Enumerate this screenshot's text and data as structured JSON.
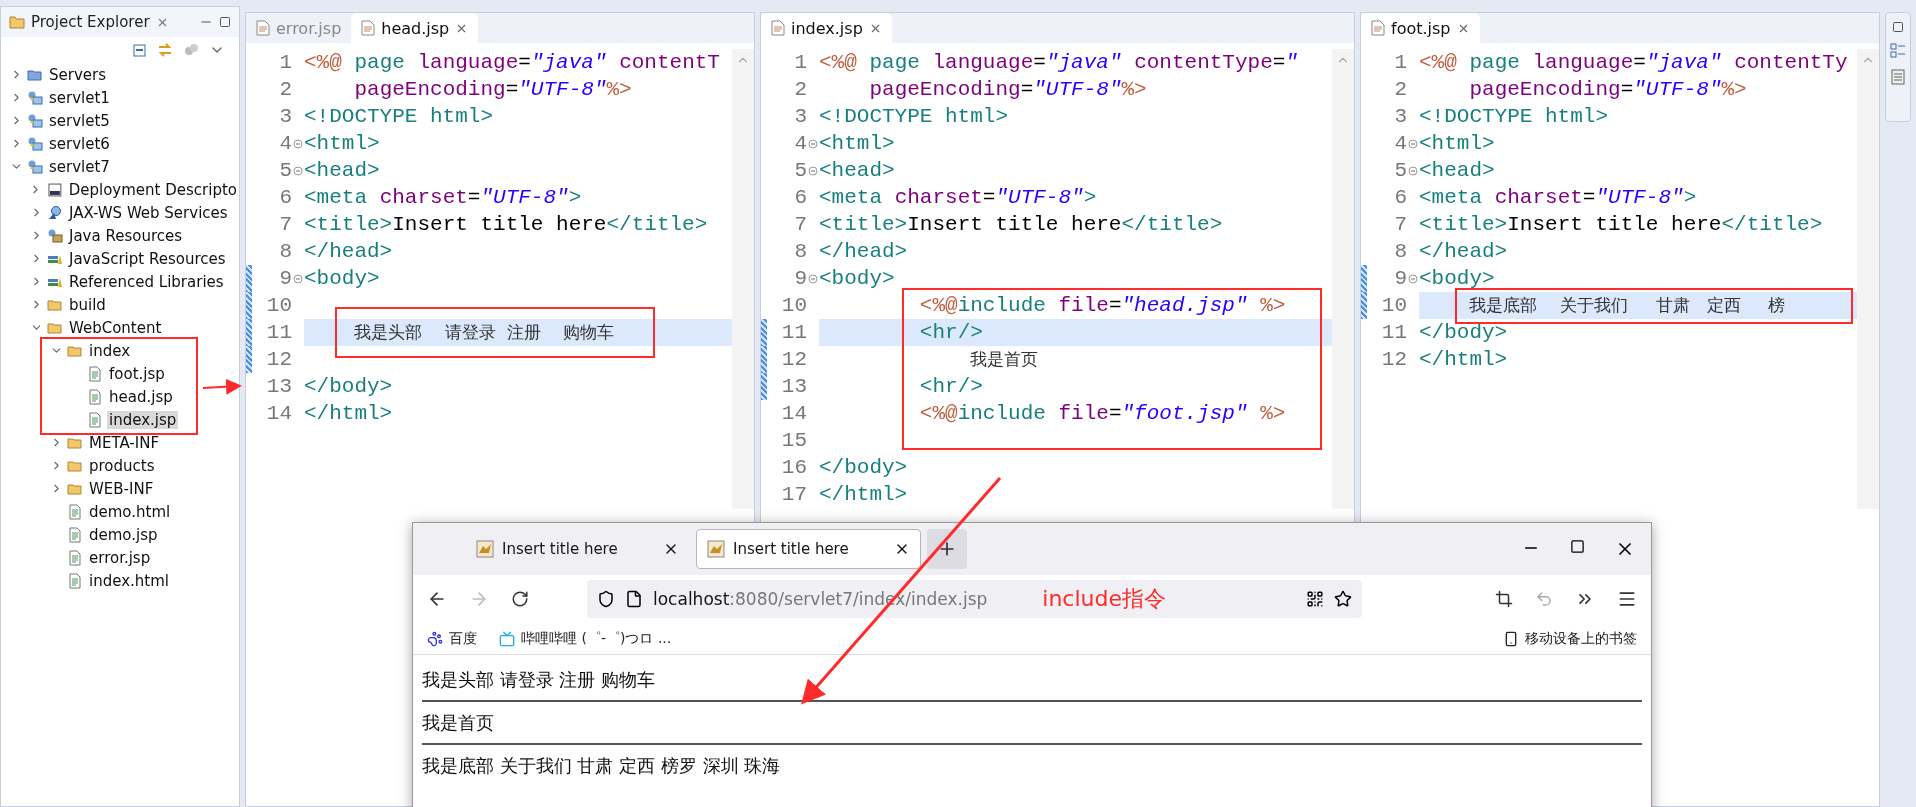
{
  "explorer": {
    "title": "Project Explorer",
    "tree": [
      {
        "label": "Servers",
        "kind": "servers",
        "expanded": false,
        "selected": false
      },
      {
        "label": "servlet1",
        "kind": "project",
        "expanded": false,
        "selected": false
      },
      {
        "label": "servlet5",
        "kind": "project",
        "expanded": false,
        "selected": false
      },
      {
        "label": "servlet6",
        "kind": "project",
        "expanded": false,
        "selected": false
      },
      {
        "label": "servlet7",
        "kind": "project",
        "expanded": true,
        "selected": false,
        "children": [
          {
            "label": "Deployment Descripto",
            "kind": "deploy",
            "expanded": false,
            "selected": false
          },
          {
            "label": "JAX-WS Web Services",
            "kind": "webservice",
            "expanded": false,
            "selected": false
          },
          {
            "label": "Java Resources",
            "kind": "javares",
            "expanded": false,
            "selected": false
          },
          {
            "label": "JavaScript Resources",
            "kind": "library",
            "expanded": false,
            "selected": false
          },
          {
            "label": "Referenced Libraries",
            "kind": "library",
            "expanded": false,
            "selected": false
          },
          {
            "label": "build",
            "kind": "folder",
            "expanded": false,
            "selected": false
          },
          {
            "label": "WebContent",
            "kind": "folder",
            "expanded": true,
            "selected": false,
            "children": [
              {
                "label": "index",
                "kind": "folder",
                "expanded": true,
                "selected": false,
                "children": [
                  {
                    "label": "foot.jsp",
                    "kind": "file",
                    "selected": false
                  },
                  {
                    "label": "head.jsp",
                    "kind": "file",
                    "selected": false
                  },
                  {
                    "label": "index.jsp",
                    "kind": "file",
                    "selected": true
                  }
                ]
              },
              {
                "label": "META-INF",
                "kind": "folder",
                "expanded": false,
                "selected": false
              },
              {
                "label": "products",
                "kind": "folder",
                "expanded": false,
                "selected": false
              },
              {
                "label": "WEB-INF",
                "kind": "folder",
                "expanded": false,
                "selected": false
              },
              {
                "label": "demo.html",
                "kind": "file",
                "selected": false
              },
              {
                "label": "demo.jsp",
                "kind": "file",
                "selected": false
              },
              {
                "label": "error.jsp",
                "kind": "file",
                "selected": false
              },
              {
                "label": "index.html",
                "kind": "file",
                "selected": false
              }
            ]
          }
        ]
      }
    ]
  },
  "editors": [
    {
      "tabs": [
        {
          "label": "error.jsp",
          "selected": false
        },
        {
          "label": "head.jsp",
          "selected": true
        }
      ],
      "lines": [
        {
          "n": "1",
          "fold": false,
          "changed": false,
          "current": false,
          "t": [
            {
              "kind": "delim",
              "text": "<%@"
            },
            {
              "kind": "tag",
              "text": " page"
            },
            {
              "kind": "attr",
              "text": " language"
            },
            {
              "kind": "text",
              "text": "="
            },
            {
              "kind": "str",
              "text": "\"java\""
            },
            {
              "kind": "attr",
              "text": " contentT"
            }
          ]
        },
        {
          "n": "2",
          "fold": false,
          "changed": false,
          "current": false,
          "t": [
            {
              "kind": "attr",
              "text": "    pageEncoding"
            },
            {
              "kind": "text",
              "text": "="
            },
            {
              "kind": "str",
              "text": "\"UTF-8\""
            },
            {
              "kind": "delim",
              "text": "%>"
            }
          ]
        },
        {
          "n": "3",
          "fold": false,
          "changed": false,
          "current": false,
          "t": [
            {
              "kind": "tag",
              "text": "<!DOCTYPE html>"
            }
          ]
        },
        {
          "n": "4",
          "fold": true,
          "changed": false,
          "current": false,
          "t": [
            {
              "kind": "tag",
              "text": "<html>"
            }
          ]
        },
        {
          "n": "5",
          "fold": true,
          "changed": false,
          "current": false,
          "t": [
            {
              "kind": "tag",
              "text": "<head>"
            }
          ]
        },
        {
          "n": "6",
          "fold": false,
          "changed": false,
          "current": false,
          "t": [
            {
              "kind": "tag",
              "text": "<meta"
            },
            {
              "kind": "attr",
              "text": " charset"
            },
            {
              "kind": "text",
              "text": "="
            },
            {
              "kind": "str",
              "text": "\"UTF-8\""
            },
            {
              "kind": "tag",
              "text": ">"
            }
          ]
        },
        {
          "n": "7",
          "fold": false,
          "changed": false,
          "current": false,
          "t": [
            {
              "kind": "tag",
              "text": "<title>"
            },
            {
              "kind": "text",
              "text": "Insert title here"
            },
            {
              "kind": "tag",
              "text": "</title>"
            }
          ]
        },
        {
          "n": "8",
          "fold": false,
          "changed": false,
          "current": false,
          "t": [
            {
              "kind": "tag",
              "text": "</head>"
            }
          ]
        },
        {
          "n": "9",
          "fold": true,
          "changed": true,
          "current": false,
          "t": [
            {
              "kind": "tag",
              "text": "<body>"
            }
          ]
        },
        {
          "n": "10",
          "fold": false,
          "changed": true,
          "current": false
        },
        {
          "n": "11",
          "fold": false,
          "changed": true,
          "current": true,
          "t": [
            {
              "kind": "cjk",
              "text": "    我是头部　 请登录  注册　 购物车"
            }
          ]
        },
        {
          "n": "12",
          "fold": false,
          "changed": true,
          "current": false
        },
        {
          "n": "13",
          "fold": false,
          "changed": false,
          "current": false,
          "t": [
            {
              "kind": "tag",
              "text": "</body>"
            }
          ]
        },
        {
          "n": "14",
          "fold": false,
          "changed": false,
          "current": false,
          "t": [
            {
              "kind": "tag",
              "text": "</html>"
            }
          ]
        }
      ]
    },
    {
      "tabs": [
        {
          "label": "index.jsp",
          "selected": true
        }
      ],
      "lines": [
        {
          "n": "1",
          "fold": false,
          "changed": false,
          "current": false,
          "t": [
            {
              "kind": "delim",
              "text": "<%@"
            },
            {
              "kind": "tag",
              "text": " page"
            },
            {
              "kind": "attr",
              "text": " language"
            },
            {
              "kind": "text",
              "text": "="
            },
            {
              "kind": "str",
              "text": "\"java\""
            },
            {
              "kind": "attr",
              "text": " contentType"
            },
            {
              "kind": "text",
              "text": "="
            },
            {
              "kind": "str",
              "text": "\""
            }
          ]
        },
        {
          "n": "2",
          "fold": false,
          "changed": false,
          "current": false,
          "t": [
            {
              "kind": "attr",
              "text": "    pageEncoding"
            },
            {
              "kind": "text",
              "text": "="
            },
            {
              "kind": "str",
              "text": "\"UTF-8\""
            },
            {
              "kind": "delim",
              "text": "%>"
            }
          ]
        },
        {
          "n": "3",
          "fold": false,
          "changed": false,
          "current": false,
          "t": [
            {
              "kind": "tag",
              "text": "<!DOCTYPE html>"
            }
          ]
        },
        {
          "n": "4",
          "fold": true,
          "changed": false,
          "current": false,
          "t": [
            {
              "kind": "tag",
              "text": "<html>"
            }
          ]
        },
        {
          "n": "5",
          "fold": true,
          "changed": false,
          "current": false,
          "t": [
            {
              "kind": "tag",
              "text": "<head>"
            }
          ]
        },
        {
          "n": "6",
          "fold": false,
          "changed": false,
          "current": false,
          "t": [
            {
              "kind": "tag",
              "text": "<meta"
            },
            {
              "kind": "attr",
              "text": " charset"
            },
            {
              "kind": "text",
              "text": "="
            },
            {
              "kind": "str",
              "text": "\"UTF-8\""
            },
            {
              "kind": "tag",
              "text": ">"
            }
          ]
        },
        {
          "n": "7",
          "fold": false,
          "changed": false,
          "current": false,
          "t": [
            {
              "kind": "tag",
              "text": "<title>"
            },
            {
              "kind": "text",
              "text": "Insert title here"
            },
            {
              "kind": "tag",
              "text": "</title>"
            }
          ]
        },
        {
          "n": "8",
          "fold": false,
          "changed": false,
          "current": false,
          "t": [
            {
              "kind": "tag",
              "text": "</head>"
            }
          ]
        },
        {
          "n": "9",
          "fold": true,
          "changed": false,
          "current": false,
          "t": [
            {
              "kind": "tag",
              "text": "<body>"
            }
          ]
        },
        {
          "n": "10",
          "fold": false,
          "changed": false,
          "current": false,
          "t": [
            {
              "kind": "delim",
              "text": "        <%@"
            },
            {
              "kind": "tag",
              "text": "include"
            },
            {
              "kind": "attr",
              "text": " file"
            },
            {
              "kind": "text",
              "text": "="
            },
            {
              "kind": "str",
              "text": "\"head.jsp\""
            },
            {
              "kind": "delim",
              "text": " %>"
            }
          ]
        },
        {
          "n": "11",
          "fold": false,
          "changed": true,
          "current": true,
          "t": [
            {
              "kind": "tag",
              "text": "        <hr/>"
            }
          ]
        },
        {
          "n": "12",
          "fold": false,
          "changed": true,
          "current": false,
          "t": [
            {
              "kind": "cjk",
              "text": "            我是首页"
            }
          ]
        },
        {
          "n": "13",
          "fold": false,
          "changed": true,
          "current": false,
          "t": [
            {
              "kind": "tag",
              "text": "        <hr/>"
            }
          ]
        },
        {
          "n": "14",
          "fold": false,
          "changed": false,
          "current": false,
          "t": [
            {
              "kind": "delim",
              "text": "        <%@"
            },
            {
              "kind": "tag",
              "text": "include"
            },
            {
              "kind": "attr",
              "text": " file"
            },
            {
              "kind": "text",
              "text": "="
            },
            {
              "kind": "str",
              "text": "\"foot.jsp\""
            },
            {
              "kind": "delim",
              "text": " %>"
            }
          ]
        },
        {
          "n": "15",
          "fold": false,
          "changed": false,
          "current": false
        },
        {
          "n": "16",
          "fold": false,
          "changed": false,
          "current": false,
          "t": [
            {
              "kind": "tag",
              "text": "</body>"
            }
          ]
        },
        {
          "n": "17",
          "fold": false,
          "changed": false,
          "current": false,
          "t": [
            {
              "kind": "tag",
              "text": "</html>"
            }
          ]
        }
      ]
    },
    {
      "tabs": [
        {
          "label": "foot.jsp",
          "selected": true
        }
      ],
      "lines": [
        {
          "n": "1",
          "fold": false,
          "changed": false,
          "current": false,
          "t": [
            {
              "kind": "delim",
              "text": "<%@"
            },
            {
              "kind": "tag",
              "text": " page"
            },
            {
              "kind": "attr",
              "text": " language"
            },
            {
              "kind": "text",
              "text": "="
            },
            {
              "kind": "str",
              "text": "\"java\""
            },
            {
              "kind": "attr",
              "text": " contentTy"
            }
          ]
        },
        {
          "n": "2",
          "fold": false,
          "changed": false,
          "current": false,
          "t": [
            {
              "kind": "attr",
              "text": "    pageEncoding"
            },
            {
              "kind": "text",
              "text": "="
            },
            {
              "kind": "str",
              "text": "\"UTF-8\""
            },
            {
              "kind": "delim",
              "text": "%>"
            }
          ]
        },
        {
          "n": "3",
          "fold": false,
          "changed": false,
          "current": false,
          "t": [
            {
              "kind": "tag",
              "text": "<!DOCTYPE html>"
            }
          ]
        },
        {
          "n": "4",
          "fold": true,
          "changed": false,
          "current": false,
          "t": [
            {
              "kind": "tag",
              "text": "<html>"
            }
          ]
        },
        {
          "n": "5",
          "fold": true,
          "changed": false,
          "current": false,
          "t": [
            {
              "kind": "tag",
              "text": "<head>"
            }
          ]
        },
        {
          "n": "6",
          "fold": false,
          "changed": false,
          "current": false,
          "t": [
            {
              "kind": "tag",
              "text": "<meta"
            },
            {
              "kind": "attr",
              "text": " charset"
            },
            {
              "kind": "text",
              "text": "="
            },
            {
              "kind": "str",
              "text": "\"UTF-8\""
            },
            {
              "kind": "tag",
              "text": ">"
            }
          ]
        },
        {
          "n": "7",
          "fold": false,
          "changed": false,
          "current": false,
          "t": [
            {
              "kind": "tag",
              "text": "<title>"
            },
            {
              "kind": "text",
              "text": "Insert title here"
            },
            {
              "kind": "tag",
              "text": "</title>"
            }
          ]
        },
        {
          "n": "8",
          "fold": false,
          "changed": false,
          "current": false,
          "t": [
            {
              "kind": "tag",
              "text": "</head>"
            }
          ]
        },
        {
          "n": "9",
          "fold": true,
          "changed": true,
          "current": false,
          "t": [
            {
              "kind": "tag",
              "text": "<body>"
            }
          ]
        },
        {
          "n": "10",
          "fold": false,
          "changed": true,
          "current": true,
          "t": [
            {
              "kind": "cjk",
              "text": "    我是底部　 关于我们　  甘肃　定西　  榜"
            }
          ]
        },
        {
          "n": "11",
          "fold": false,
          "changed": false,
          "current": false,
          "t": [
            {
              "kind": "tag",
              "text": "</body>"
            }
          ]
        },
        {
          "n": "12",
          "fold": false,
          "changed": false,
          "current": false,
          "t": [
            {
              "kind": "tag",
              "text": "</html>"
            }
          ]
        }
      ]
    }
  ],
  "browser": {
    "tabs": [
      {
        "label": "Insert title here",
        "selected": false
      },
      {
        "label": "Insert title here",
        "selected": true
      }
    ],
    "url_host": "localhost",
    "url_rest": ":8080/servlet7/index/index.jsp",
    "bookmarks": [
      {
        "label": "百度",
        "kind": "paw"
      },
      {
        "label": "哔哩哔哩 (゜-゜)つロ ...",
        "kind": "tv"
      }
    ],
    "mobile_bookmarks": "移动设备上的书签",
    "content": [
      "我是头部 请登录 注册 购物车",
      "我是首页",
      "我是底部 关于我们 甘肃 定西 榜罗 深圳 珠海"
    ]
  },
  "annotation": "include指令"
}
